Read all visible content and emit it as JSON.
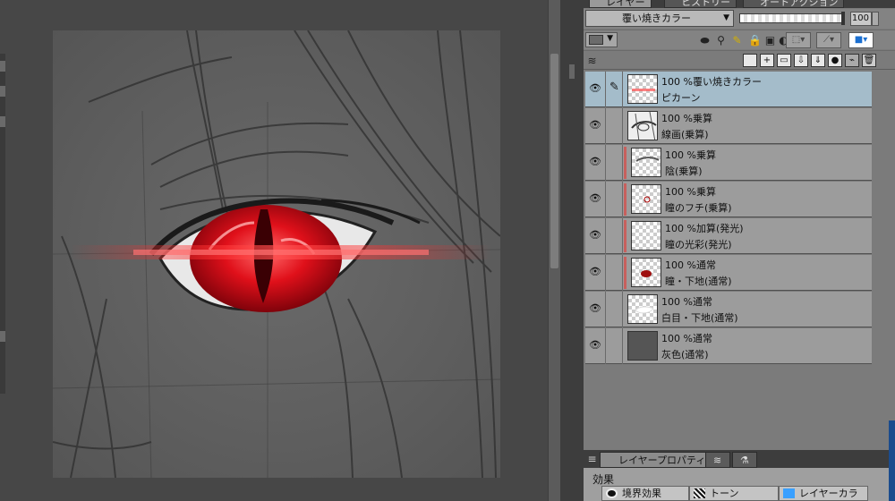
{
  "panel_tabs": [
    "レイヤー",
    "ヒストリー",
    "オートアクション"
  ],
  "blend_mode": "覆い焼きカラー",
  "opacity": "100",
  "opacity_fraction": 1.0,
  "tool_icons": [
    "layer-color-icon",
    "clipping-icon",
    "reference-layer-icon",
    "draft-layer-icon",
    "lock-icon",
    "lock-transparency-icon",
    "mask-enable-icon",
    "ruler-display-icon",
    "layer-color-swatch-icon"
  ],
  "command_icons": [
    "new-raster-layer-icon",
    "new-vector-layer-icon",
    "new-folder-icon",
    "transfer-down-icon",
    "merge-down-icon",
    "layer-mask-icon",
    "apply-mask-icon",
    "delete-layer-icon"
  ],
  "layers": [
    {
      "pct": "100 %覆い焼きカラー",
      "name": "ピカーン",
      "selected": true,
      "clip": false,
      "editing": true,
      "thumb": "glow"
    },
    {
      "pct": "100 %乗算",
      "name": "線画(乗算)",
      "selected": false,
      "clip": false,
      "editing": false,
      "thumb": "sketch"
    },
    {
      "pct": "100 %乗算",
      "name": "陰(乗算)",
      "selected": false,
      "clip": true,
      "editing": false,
      "thumb": "shadow"
    },
    {
      "pct": "100 %乗算",
      "name": "瞳のフチ(乗算)",
      "selected": false,
      "clip": true,
      "editing": false,
      "thumb": "rim"
    },
    {
      "pct": "100 %加算(発光)",
      "name": "瞳の光彩(発光)",
      "selected": false,
      "clip": true,
      "editing": false,
      "thumb": "blank"
    },
    {
      "pct": "100 %通常",
      "name": "瞳・下地(通常)",
      "selected": false,
      "clip": true,
      "editing": false,
      "thumb": "iris"
    },
    {
      "pct": "100 %通常",
      "name": "白目・下地(通常)",
      "selected": false,
      "clip": false,
      "editing": false,
      "thumb": "white"
    },
    {
      "pct": "100 %通常",
      "name": "灰色(通常)",
      "selected": false,
      "clip": false,
      "editing": false,
      "thumb": "gray"
    }
  ],
  "props_tabs": [
    "レイヤープロパティ",
    "",
    ""
  ],
  "effect_label": "効果",
  "effect_buttons": [
    "境界効果",
    "トーン",
    "レイヤーカラー"
  ]
}
